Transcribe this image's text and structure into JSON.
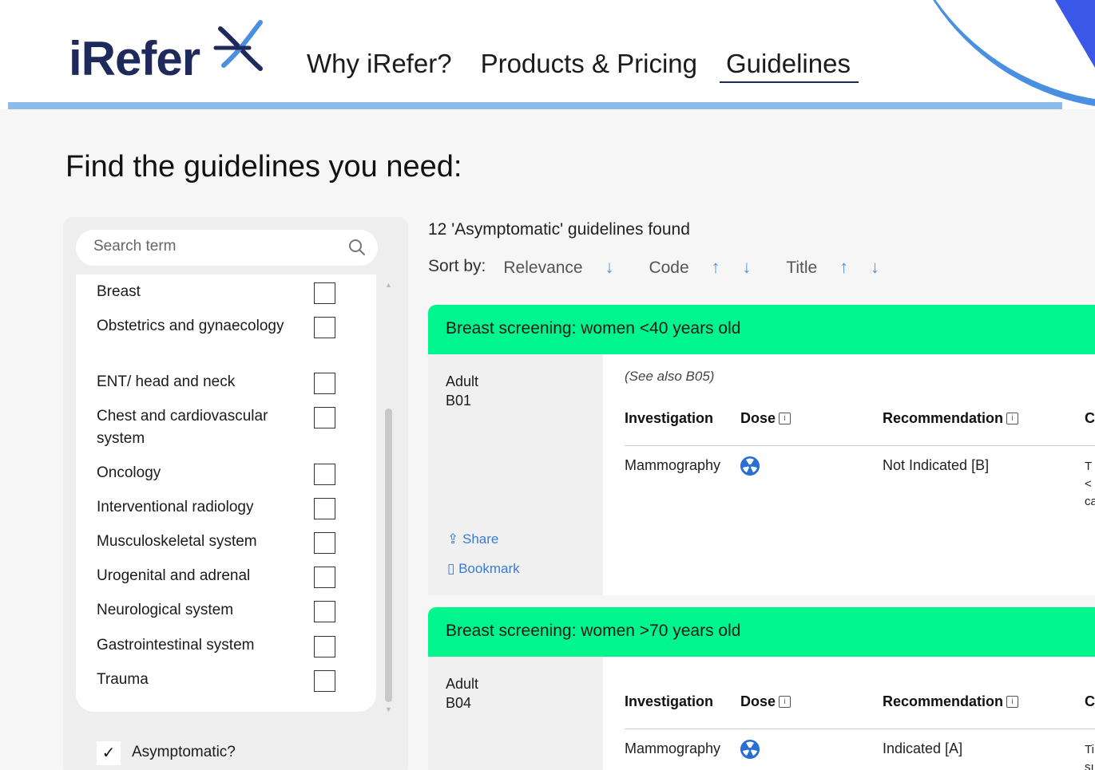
{
  "header": {
    "logo_text": "iRefer",
    "nav": [
      "Why iRefer?",
      "Products & Pricing",
      "Guidelines"
    ],
    "active_nav": "Guidelines"
  },
  "page_title": "Find the guidelines you need:",
  "sidebar": {
    "search_placeholder": "Search term",
    "filters": [
      "Breast",
      "Obstetrics and gynaecology",
      "ENT/ head and neck",
      "Chest and cardiovascular system",
      "Oncology",
      "Interventional radiology",
      "Musculoskeletal system",
      "Urogenital and adrenal",
      "Neurological system",
      "Gastrointestinal system",
      "Trauma"
    ],
    "asymptomatic_label": "Asymptomatic?",
    "asymptomatic_checked": true
  },
  "results": {
    "count_text": "12 'Asymptomatic' guidelines found",
    "sort_label": "Sort by:",
    "sort_options": [
      "Relevance",
      "Code",
      "Title"
    ],
    "cards": [
      {
        "title": "Breast screening: women <40 years old",
        "age": "Adult",
        "code": "B01",
        "see_also": "(See also B05)",
        "columns": [
          "Investigation",
          "Dose",
          "Recommendation",
          "C"
        ],
        "row": {
          "investigation": "Mammography",
          "recommendation": "Not Indicated [B]",
          "comment_clip": [
            "T",
            "<",
            "ca"
          ]
        },
        "share": "Share",
        "bookmark": "Bookmark"
      },
      {
        "title": "Breast screening: women >70 years old",
        "age": "Adult",
        "code": "B04",
        "columns": [
          "Investigation",
          "Dose",
          "Recommendation",
          "C"
        ],
        "row": {
          "investigation": "Mammography",
          "recommendation": "Indicated [A]",
          "comment_clip": [
            "Ti",
            "sı"
          ]
        }
      }
    ]
  },
  "colors": {
    "accent_green": "#00f58e",
    "brand_navy": "#1f2a5c",
    "link_blue": "#3a7bd5"
  },
  "icons": [
    "search-icon",
    "radiation-dose-icon",
    "info-icon",
    "share-icon",
    "bookmark-icon",
    "checkmark-icon",
    "sort-arrow-icon"
  ]
}
